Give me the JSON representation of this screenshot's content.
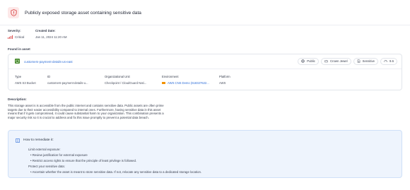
{
  "header": {
    "title": "Publicly exposed storage asset containing sensitive data",
    "icon": "shield-alert-icon"
  },
  "meta": {
    "severity_label": "Severity:",
    "severity_value": "Critical",
    "created_label": "Created Date:",
    "created_value": "Jan 11, 2024 11:20 AM"
  },
  "found_in": {
    "label": "Found in asset",
    "asset_name": "customers-payment-details-us-east",
    "tags": [
      {
        "icon": "globe-icon",
        "label": "Public"
      },
      {
        "icon": "crown-icon",
        "label": "Crown Jewel"
      },
      {
        "icon": "document-icon",
        "label": "Sensitive"
      },
      {
        "icon": "gauge-icon",
        "label": "9.6"
      }
    ],
    "columns": {
      "type_label": "Type",
      "type_value": "AWS S3 Bucket",
      "id_label": "ID",
      "id_value": "customers-payment-details-u...",
      "org_label": "Organizational Unit",
      "org_value": "Checkpoint / CloudGuard Nati...",
      "env_label": "Environment",
      "env_value": "AWS CNS Demo (618327622...",
      "platform_label": "Platform",
      "platform_value": "AWS"
    }
  },
  "description": {
    "label": "Description:",
    "text": "This storage asset is is accessible from the public internet and contains sensitive data. Public assets are often prime targets due to their easier accessibility compared to internal ones. Furthermore, having sensitive data in this asset means that if it gets compromised, it could cause substantial harm to your organization. This combination presents a major security risk so it is crucial to address and fix this issue promptly to prevent a potential data breach."
  },
  "remediation": {
    "title": "How to remediate it:",
    "limit_heading": "Limit external exposure:",
    "limit_items": [
      "Review justification for external exposure",
      "Restrict access rights to ensure that the principle of least privilege is followed."
    ],
    "protect_heading": "Protect your sensitive data:",
    "protect_items": [
      "Ascertain whether the asset is meant to store sensitive data. If not, relocate any sensitive data to a dedicated storage location."
    ]
  },
  "colors": {
    "critical": "#d94848",
    "link": "#2b6cd8",
    "info_bg": "#eef4fd"
  }
}
